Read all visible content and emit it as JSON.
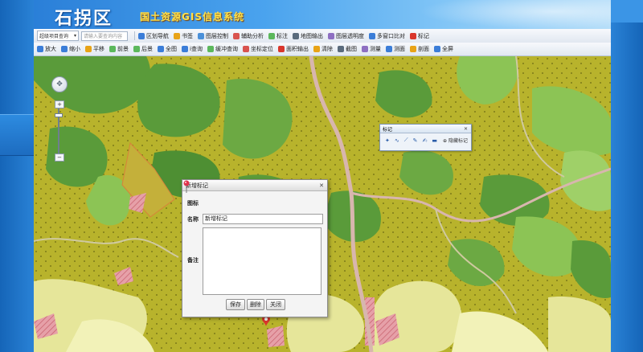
{
  "header": {
    "district": "石拐区",
    "system_title": "国土资源GIS信息系统"
  },
  "toolbar1": {
    "layer_select": "超级项目查询",
    "search_placeholder": "请输入要查询内容",
    "items": [
      {
        "label": "区划导航",
        "icon": "compass-icon",
        "color": "#3b7dd8"
      },
      {
        "label": "书签",
        "icon": "star-icon",
        "color": "#e8a317"
      },
      {
        "label": "图层控制",
        "icon": "layers-icon",
        "color": "#4a90d9"
      },
      {
        "label": "辅助分析",
        "icon": "chart-icon",
        "color": "#d9534f"
      },
      {
        "label": "标注",
        "icon": "tag-icon",
        "color": "#5cb85c"
      },
      {
        "label": "地图输出",
        "icon": "print-icon",
        "color": "#5a6b7d"
      },
      {
        "label": "图层透明度",
        "icon": "opacity-icon",
        "color": "#8e6fc2"
      },
      {
        "label": "多窗口比对",
        "icon": "window-icon",
        "color": "#3b7dd8"
      },
      {
        "label": "标记",
        "icon": "pin-icon",
        "color": "#d9362c"
      }
    ]
  },
  "toolbar2": {
    "items": [
      {
        "label": "放大",
        "icon": "zoom-in-icon",
        "color": "#3b7dd8"
      },
      {
        "label": "缩小",
        "icon": "zoom-out-icon",
        "color": "#3b7dd8"
      },
      {
        "label": "平移",
        "icon": "pan-icon",
        "color": "#e8a317"
      },
      {
        "label": "前景",
        "icon": "back-icon",
        "color": "#5cb85c"
      },
      {
        "label": "后景",
        "icon": "forward-icon",
        "color": "#5cb85c"
      },
      {
        "label": "全图",
        "icon": "globe-icon",
        "color": "#3b7dd8"
      },
      {
        "label": "i查询",
        "icon": "info-icon",
        "color": "#3b7dd8"
      },
      {
        "label": "缓冲查询",
        "icon": "buffer-icon",
        "color": "#5cb85c"
      },
      {
        "label": "坐标定位",
        "icon": "locate-icon",
        "color": "#d9534f"
      },
      {
        "label": "面积输出",
        "icon": "flag-icon",
        "color": "#d9362c"
      },
      {
        "label": "清除",
        "icon": "clear-icon",
        "color": "#e8a317"
      },
      {
        "label": "截图",
        "icon": "screenshot-icon",
        "color": "#5a6b7d"
      },
      {
        "label": "测量",
        "icon": "measure-icon",
        "color": "#8e6fc2"
      },
      {
        "label": "测面",
        "icon": "area-icon",
        "color": "#3b7dd8"
      },
      {
        "label": "剖面",
        "icon": "profile-icon",
        "color": "#e8a317"
      },
      {
        "label": "全屏",
        "icon": "fullscreen-icon",
        "color": "#3b7dd8"
      }
    ]
  },
  "mark_panel": {
    "title": "标记",
    "hide_label": "隐藏标记"
  },
  "dialog": {
    "title": "新增标记",
    "icon_label": "图标",
    "name_label": "名称",
    "name_value": "新增标记",
    "note_label": "备注",
    "note_value": "",
    "save": "保存",
    "delete": "删除",
    "close": "关闭"
  },
  "colors": {
    "map_base": "#b8b32c",
    "forest": "#5a9b3a",
    "meadow": "#8cc455",
    "field": "#e6e69a",
    "road": "#d8b6ae",
    "residential": "#e6a0a8"
  }
}
